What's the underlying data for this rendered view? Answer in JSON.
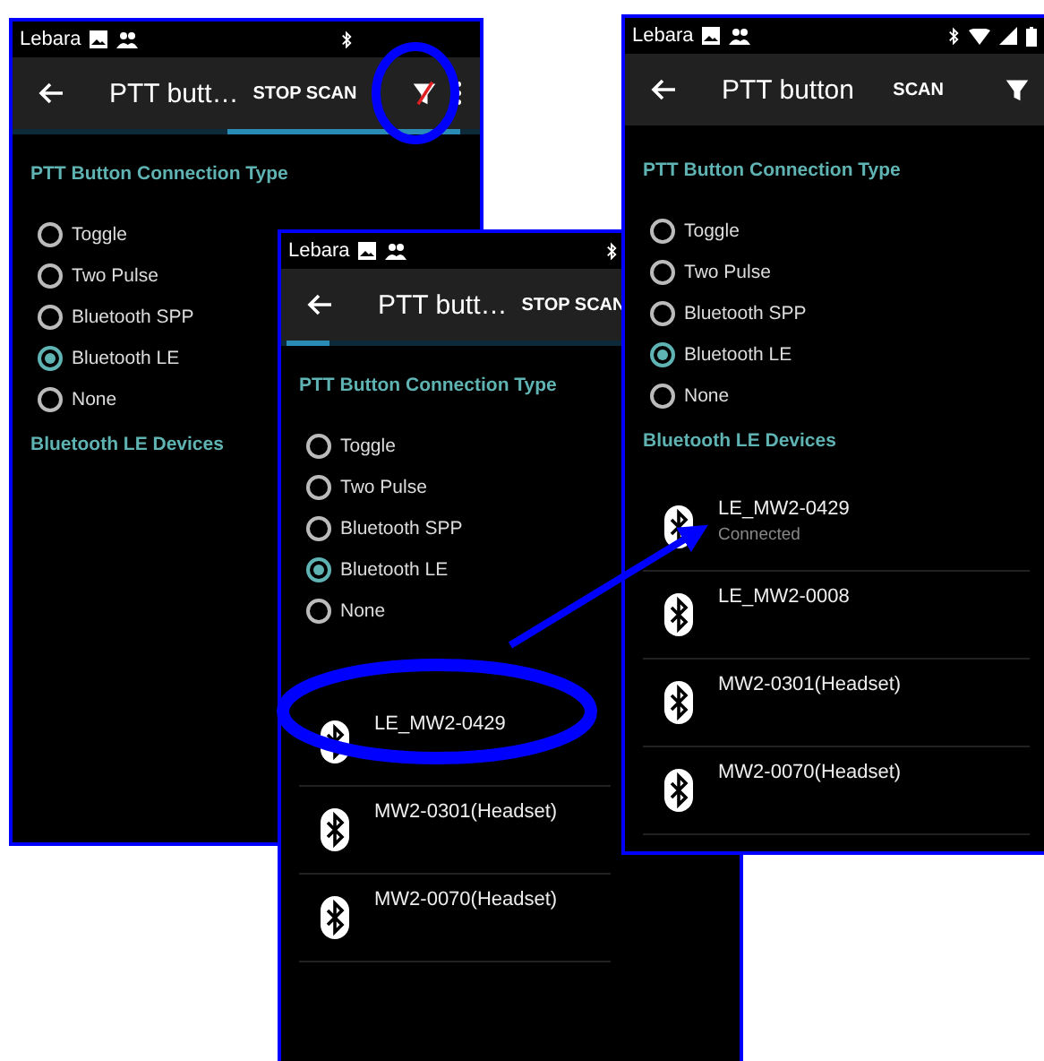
{
  "screens": [
    {
      "status_bar": {
        "carrier": "Lebara"
      },
      "toolbar": {
        "title": "PTT butt…",
        "action": "STOP SCAN",
        "filter": {
          "crossed": true
        },
        "overflow_menu": true
      },
      "scanning": true,
      "connection_type": {
        "heading": "PTT Button Connection Type",
        "options": [
          {
            "label": "Toggle",
            "selected": false
          },
          {
            "label": "Two Pulse",
            "selected": false
          },
          {
            "label": "Bluetooth SPP",
            "selected": false
          },
          {
            "label": "Bluetooth LE",
            "selected": true
          },
          {
            "label": "None",
            "selected": false
          }
        ]
      },
      "devices": {
        "heading": "Bluetooth LE Devices"
      }
    },
    {
      "status_bar": {
        "carrier": "Lebara"
      },
      "toolbar": {
        "title": "PTT butt…",
        "action": "STOP SCAN"
      },
      "scanning": true,
      "connection_type": {
        "heading": "PTT Button Connection Type",
        "options": [
          {
            "label": "Toggle",
            "selected": false
          },
          {
            "label": "Two Pulse",
            "selected": false
          },
          {
            "label": "Bluetooth SPP",
            "selected": false
          },
          {
            "label": "Bluetooth LE",
            "selected": true
          },
          {
            "label": "None",
            "selected": false
          }
        ]
      },
      "devices": {
        "items": [
          {
            "name": "LE_MW2-0429"
          },
          {
            "name": "MW2-0301(Headset)"
          },
          {
            "name": "MW2-0070(Headset)"
          }
        ]
      }
    },
    {
      "status_bar": {
        "carrier": "Lebara"
      },
      "toolbar": {
        "title": "PTT button",
        "action": "SCAN",
        "filter": {
          "crossed": false
        }
      },
      "connection_type": {
        "heading": "PTT Button Connection Type",
        "options": [
          {
            "label": "Toggle",
            "selected": false
          },
          {
            "label": "Two Pulse",
            "selected": false
          },
          {
            "label": "Bluetooth SPP",
            "selected": false
          },
          {
            "label": "Bluetooth LE",
            "selected": true
          },
          {
            "label": "None",
            "selected": false
          }
        ]
      },
      "devices": {
        "heading": "Bluetooth LE Devices",
        "items": [
          {
            "name": "LE_MW2-0429",
            "status": "Connected"
          },
          {
            "name": "LE_MW2-0008"
          },
          {
            "name": "MW2-0301(Headset)"
          },
          {
            "name": "MW2-0070(Headset)"
          }
        ]
      }
    }
  ]
}
